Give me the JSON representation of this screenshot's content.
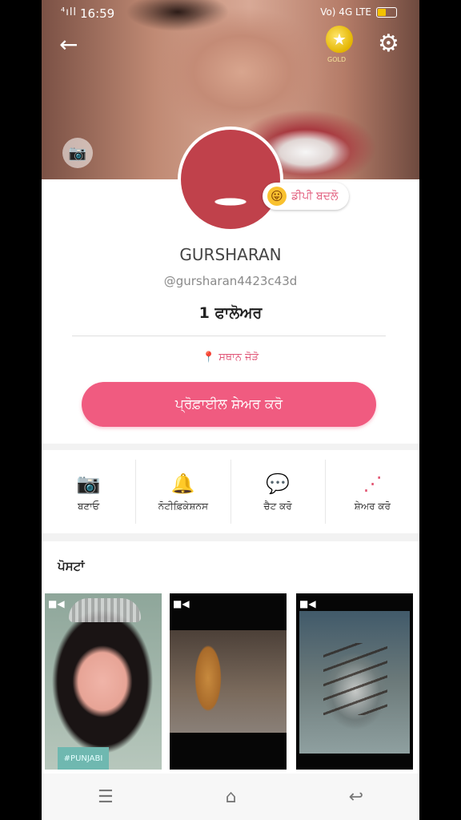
{
  "status": {
    "time": "16:59",
    "left_icons": "⁴ıll",
    "net": "Vo) 4G LTE"
  },
  "header": {
    "back_icon": "←",
    "gold_label": "GOLD",
    "gold_icon": "★",
    "settings_icon": "⚙",
    "camera_icon": "📷"
  },
  "profile": {
    "dp_change_label": "ਡੀਪੀ ਬਦਲੋ",
    "emoji": "😛",
    "name": "GURSHARAN",
    "handle": "@gursharan4423c43d",
    "followers": "1 ਫਾਲੋਅਰ",
    "location": "ਸਥਾਨ ਜੋੜੋ",
    "location_icon": "📍",
    "share_profile": "ਪ੍ਰੋਫ਼ਾਈਲ ਸ਼ੇਅਰ ਕਰੋ"
  },
  "actions": [
    {
      "icon": "📷",
      "label": "ਬਣਾਓ"
    },
    {
      "icon": "🔔",
      "label": "ਨੋਟੀਫ਼ਿਕੇਸ਼ਨਸ"
    },
    {
      "icon": "💬",
      "label": "ਚੈਟ ਕਰੋ"
    },
    {
      "icon": "⋰",
      "label": "ਸ਼ੇਅਰ ਕਰੋ"
    }
  ],
  "posts": {
    "title": "ਪੋਸਟਾਂ",
    "tag": "#PUNJABI",
    "video_icon": "■◀"
  },
  "navbar": {
    "menu_icon": "☰",
    "home_icon": "⌂",
    "back_icon": "↩"
  },
  "colors": {
    "accent": "#f05b80",
    "accent_text": "#e05476"
  }
}
